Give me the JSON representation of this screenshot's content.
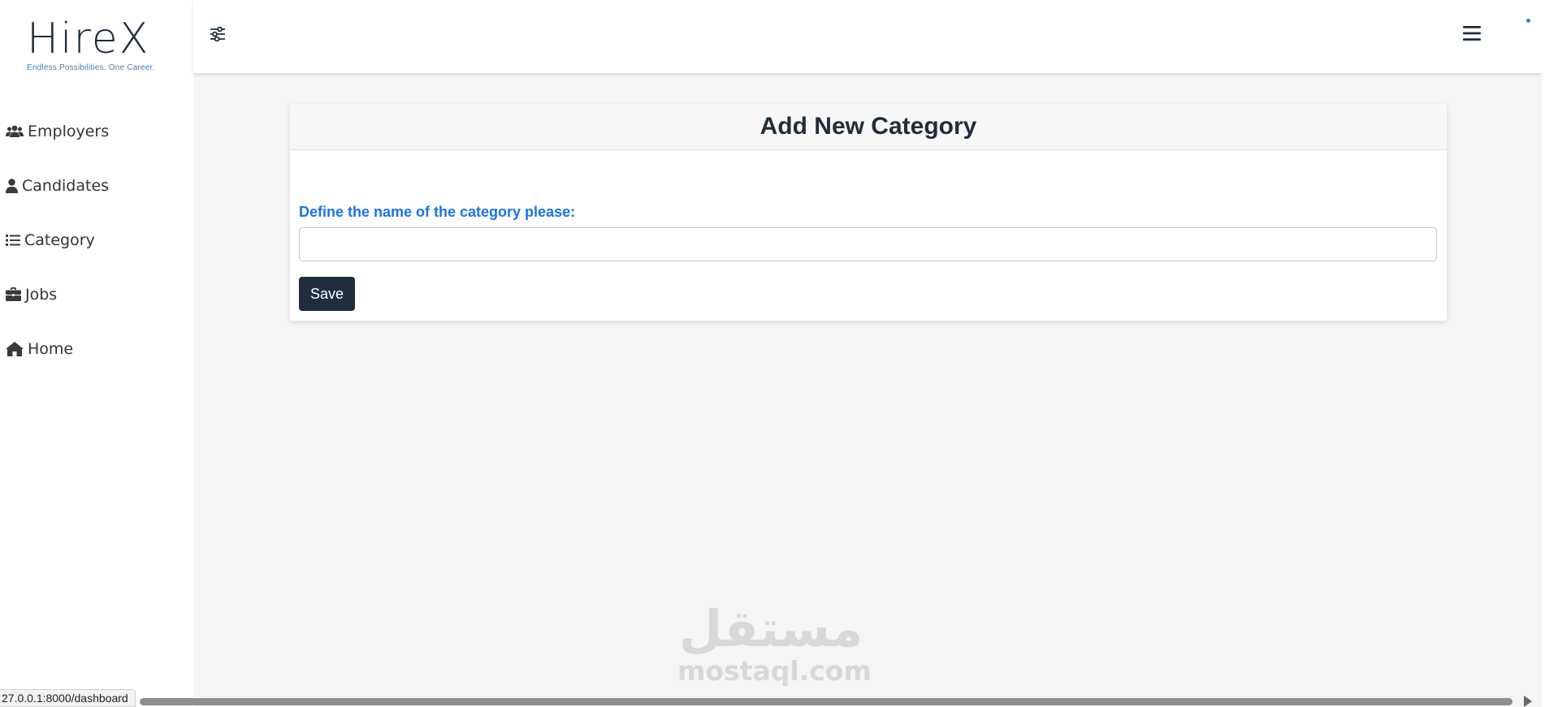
{
  "brand": {
    "name": "HireX",
    "tagline": "Endless Possibilities. One Career."
  },
  "sidebar": {
    "items": [
      {
        "label": "Employers",
        "icon": "users-icon"
      },
      {
        "label": "Candidates",
        "icon": "user-icon"
      },
      {
        "label": "Category",
        "icon": "list-icon"
      },
      {
        "label": "Jobs",
        "icon": "briefcase-icon"
      },
      {
        "label": "Home",
        "icon": "home-icon"
      }
    ]
  },
  "topbar": {
    "filter_icon": "sliders-icon",
    "menu_icon": "hamburger-icon"
  },
  "form": {
    "title": "Add New Category",
    "label": "Define the name of the category please:",
    "input_value": "",
    "save_label": "Save"
  },
  "watermark": {
    "arabic": "مستقل",
    "latin": "mostaql.com"
  },
  "statusbar": {
    "url": "27.0.0.1:8000/dashboard"
  },
  "colors": {
    "primary": "#1f2d3d",
    "label_blue": "#1a73e8",
    "background": "#f5f5f5",
    "accent_dot": "#1e88e5"
  }
}
